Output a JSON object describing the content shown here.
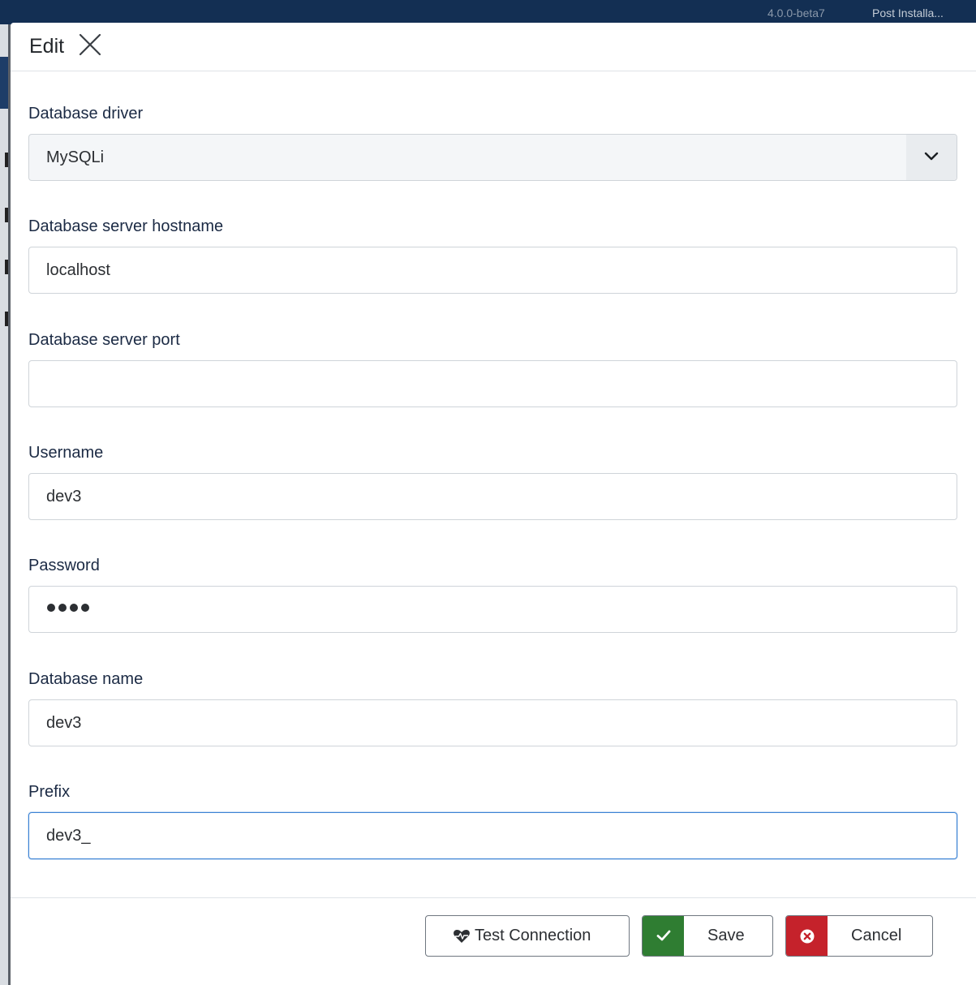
{
  "background": {
    "topbar_items": [
      "4.0.0-beta7",
      "Post Installa..."
    ]
  },
  "modal": {
    "title": "Edit",
    "close_icon": "close-icon"
  },
  "fields": {
    "driver": {
      "label": "Database driver",
      "value": "MySQLi",
      "icon": "chevron-down-icon"
    },
    "hostname": {
      "label": "Database server hostname",
      "value": "localhost"
    },
    "port": {
      "label": "Database server port",
      "value": ""
    },
    "username": {
      "label": "Username",
      "value": "dev3"
    },
    "password": {
      "label": "Password",
      "masked_length": 4
    },
    "dbname": {
      "label": "Database name",
      "value": "dev3"
    },
    "prefix": {
      "label": "Prefix",
      "value": "dev3_"
    }
  },
  "footer": {
    "test_connection": {
      "label": "Test Connection",
      "icon": "heartbeat-icon"
    },
    "save": {
      "label": "Save",
      "icon": "check-icon",
      "color": "#2f7d32"
    },
    "cancel": {
      "label": "Cancel",
      "icon": "times-circle-icon",
      "color": "#c5222b"
    }
  },
  "colors": {
    "focus_border": "#3b82d4",
    "label_text": "#1b2a44"
  }
}
